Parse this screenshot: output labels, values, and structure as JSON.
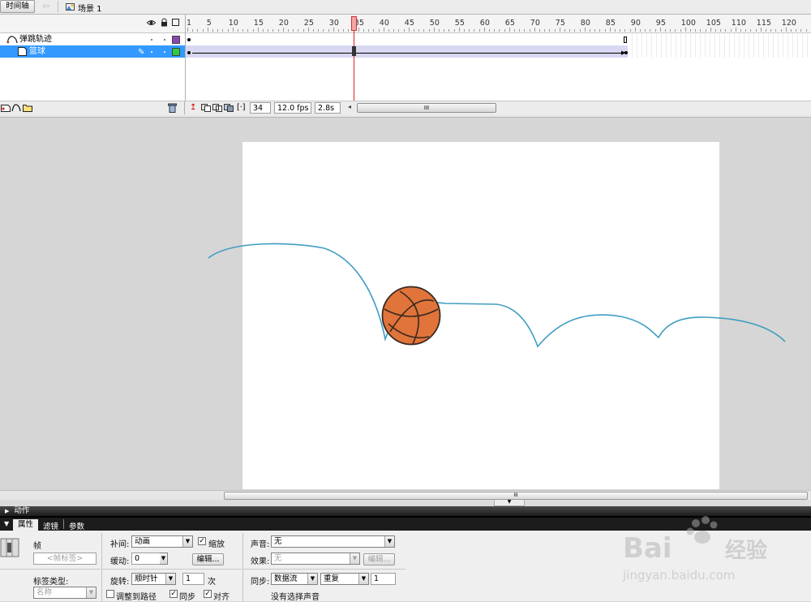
{
  "topbar": {
    "timeline_button": "时间轴",
    "scene_label": "场景 1"
  },
  "timeline": {
    "ruler": [
      "1",
      "5",
      "10",
      "15",
      "20",
      "25",
      "30",
      "35",
      "40",
      "45",
      "50",
      "55",
      "60",
      "65",
      "70",
      "75",
      "80",
      "85",
      "90",
      "95",
      "100",
      "105",
      "110",
      "115",
      "120"
    ],
    "layers": [
      {
        "name": "弹跳轨迹",
        "color": "#8e44ad",
        "selected": false
      },
      {
        "name": "篮球",
        "color": "#2ecc40",
        "selected": true
      }
    ],
    "current_frame": "34",
    "fps": "12.0 fps",
    "elapsed": "2.8s",
    "scroll_grip": "III"
  },
  "stage": {
    "bg": "#ffffff",
    "ball_color": "#e0743a"
  },
  "panels": {
    "actions_label": "动作",
    "tabs": [
      "属性",
      "滤镜",
      "参数"
    ],
    "frame_label": "帧",
    "frame_label_placeholder": "<帧标签>",
    "label_type_label": "标签类型:",
    "label_type_value": "名称",
    "tween_label": "补间:",
    "tween_value": "动画",
    "scale_label": "缩放",
    "ease_label": "缓动:",
    "ease_value": "0",
    "edit_button": "编辑...",
    "rotate_label": "旋转:",
    "rotate_value": "顺时针",
    "rotate_times": "1",
    "times_unit": "次",
    "orient_path_label": "调整到路径",
    "sync_label": "同步",
    "snap_label": "对齐",
    "sound_label": "声音:",
    "sound_value": "无",
    "effect_label": "效果:",
    "effect_value": "无",
    "effect_edit": "编辑...",
    "sync_sound_label": "同步:",
    "sync_sound_value": "数据流",
    "repeat_value": "重复",
    "repeat_count": "1",
    "no_sound": "没有选择声音"
  },
  "watermark": {
    "brand": "Baidu经验",
    "url": "jingyan.baidu.com"
  }
}
